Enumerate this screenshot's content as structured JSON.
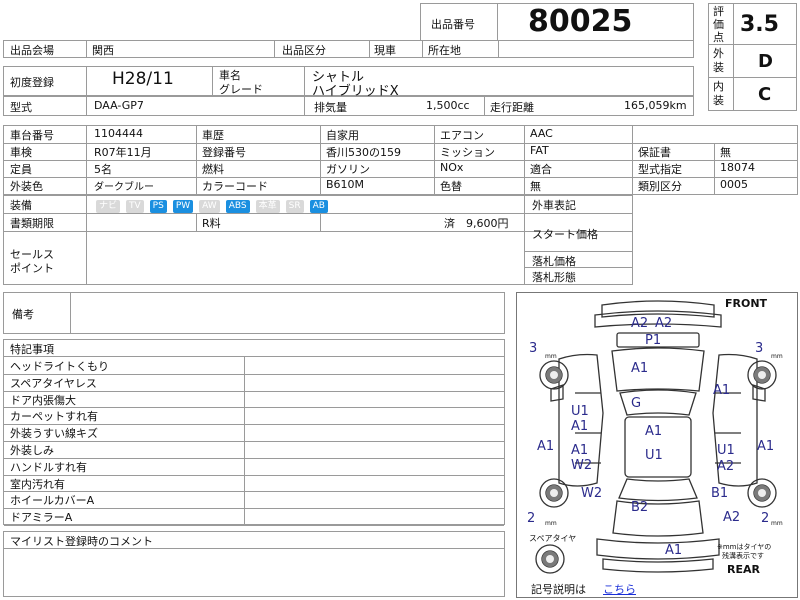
{
  "header": {
    "lot_label": "出品番号",
    "lot_number": "80025",
    "eval_label": "評価点",
    "eval_score": "3.5",
    "exterior_label": "外装",
    "exterior_grade": "D",
    "interior_label": "内装",
    "interior_grade": "C"
  },
  "row1": {
    "venue_label": "出品会場",
    "venue": "関西",
    "category_label": "出品区分",
    "category": "現車",
    "location_label": "所在地",
    "location": ""
  },
  "row2": {
    "first_reg_label": "初度登録",
    "first_reg": "H28/11",
    "name_label": "車名",
    "grade_label": "グレード",
    "car_name": "シャトル",
    "grade": "ハイブリッドX"
  },
  "row3": {
    "model_label": "型式",
    "model": "DAA-GP7",
    "displacement_label": "排気量",
    "displacement": "1,500cc",
    "mileage_label": "走行距離",
    "mileage": "165,059km"
  },
  "details": {
    "chassis_label": "車台番号",
    "chassis": "1104444",
    "history_label": "車歴",
    "history": "自家用",
    "aircon_label": "エアコン",
    "aircon": "AAC",
    "inspection_label": "車検",
    "inspection": "R07年11月",
    "regno_label": "登録番号",
    "regno": "香川530の159",
    "mission_label": "ミッション",
    "mission": "FAT",
    "warranty_label": "保証書",
    "warranty": "無",
    "capacity_label": "定員",
    "capacity": "5名",
    "fuel_label": "燃料",
    "fuel": "ガソリン",
    "nox_label": "NOx",
    "nox": "",
    "conform_label": "適合",
    "conform": "",
    "typespec_label": "型式指定",
    "typespec": "18074",
    "color_label": "外装色",
    "color": "ダークブルー",
    "colorcode_label": "カラーコード",
    "colorcode": "B610M",
    "repaint_label": "色替",
    "repaint": "無",
    "classno_label": "類別区分",
    "classno": "0005"
  },
  "equipment": {
    "label": "装備",
    "items": [
      {
        "name": "ナビ",
        "on": false
      },
      {
        "name": "TV",
        "on": false
      },
      {
        "name": "PS",
        "on": true
      },
      {
        "name": "PW",
        "on": true
      },
      {
        "name": "AW",
        "on": false
      },
      {
        "name": "ABS",
        "on": true
      },
      {
        "name": "本革",
        "on": false
      },
      {
        "name": "SR",
        "on": false
      },
      {
        "name": "AB",
        "on": true
      }
    ],
    "export_label": "外車表記"
  },
  "docs": {
    "deadline_label": "書類期限",
    "r_fee_label": "R料",
    "r_fee": "済　9,600円",
    "start_price_label": "スタート価格"
  },
  "sales": {
    "label": "セールスポイント",
    "label_l1": "セールス",
    "label_l2": "ポイント",
    "bid_price_label": "落札価格",
    "bid_type_label": "落札形態"
  },
  "remarks_label": "備考",
  "notes": {
    "label": "特記事項",
    "items": [
      "ヘッドライトくもり",
      "スペアタイヤレス",
      "ドア内張傷大",
      "カーペットすれ有",
      "外装うすい線キズ",
      "外装しみ",
      "ハンドルすれ有",
      "室内汚れ有",
      "ホイールカバーA",
      "ドアミラーA"
    ]
  },
  "comment_label": "マイリスト登録時のコメント",
  "diagram": {
    "front": "FRONT",
    "rear": "REAR",
    "spare": "スペアタイヤ",
    "tire_note_l1": "※mmはタイヤの",
    "tire_note_l2": "残溝表示です",
    "mm": "mm",
    "legend_label": "記号説明は",
    "legend_link": "こちら",
    "marks": {
      "a2a": "A2",
      "a2b": "A2",
      "p1": "P1",
      "fl3": "3",
      "fr3": "3",
      "a1top": "A1",
      "a1r1": "A1",
      "g": "G",
      "u1l": "U1",
      "a1l": "A1",
      "a1c": "A1",
      "a1left": "A1",
      "a1l2": "A1",
      "u1c": "U1",
      "w2l": "W2",
      "u1r": "U1",
      "a2r": "A2",
      "a1right": "A1",
      "w2rear": "W2",
      "b1": "B1",
      "a2rear": "A2",
      "b2": "B2",
      "rl2": "2",
      "rr2": "2",
      "a1bottom": "A1"
    }
  }
}
